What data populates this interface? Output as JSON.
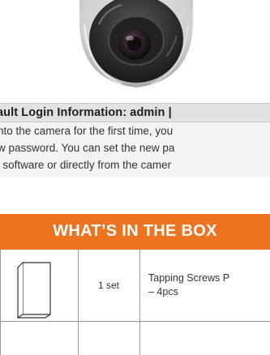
{
  "camera_image": {
    "alt_name": "dome-camera"
  },
  "login": {
    "title": "ault Login Information: admin |"
  },
  "instructions": {
    "lines": [
      "nto the camera for the first time, you",
      "w password. You can set the new pa",
      "' software or directly from the camer"
    ]
  },
  "box": {
    "title": "WHAT’S IN THE BOX",
    "header_color": "#ee7320",
    "rows": [
      {
        "icon": "manual-booklet-icon",
        "qty": "1 set",
        "desc_line1": "Tapping Screws P",
        "desc_line2": "– 4pcs"
      }
    ]
  }
}
